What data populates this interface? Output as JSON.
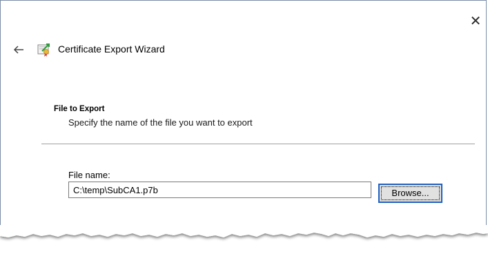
{
  "window": {
    "close_glyph": "✕"
  },
  "header": {
    "back_icon": "back-arrow-icon",
    "wizard_icon": "certificate-icon",
    "title": "Certificate Export Wizard"
  },
  "section": {
    "heading": "File to Export",
    "subtitle": "Specify the name of the file you want to export"
  },
  "form": {
    "file_name_label": "File name:",
    "file_name_value": "C:\\temp\\SubCA1.p7b",
    "browse_label": "Browse..."
  },
  "colors": {
    "focus_border": "#1f5fbf",
    "button_face": "#e1e1e1",
    "divider": "#a0a0a0"
  }
}
